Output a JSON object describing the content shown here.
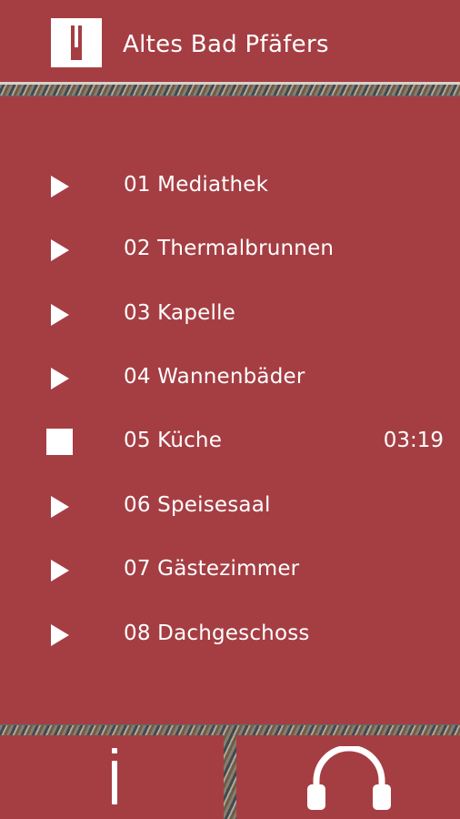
{
  "header": {
    "app_title": "Altes Bad Pfäfers",
    "logo_icon": "logo-icon"
  },
  "tracks": [
    {
      "label": "01 Mediathek",
      "state": "play",
      "icon": "play-icon"
    },
    {
      "label": "02 Thermalbrunnen",
      "state": "play",
      "icon": "play-icon"
    },
    {
      "label": "03 Kapelle",
      "state": "play",
      "icon": "play-icon"
    },
    {
      "label": "04 Wannenbäder",
      "state": "play",
      "icon": "play-icon"
    },
    {
      "label": "05 Küche",
      "state": "stop",
      "icon": "stop-icon",
      "time": "03:19"
    },
    {
      "label": "06 Speisesaal",
      "state": "play",
      "icon": "play-icon"
    },
    {
      "label": "07 Gästezimmer",
      "state": "play",
      "icon": "play-icon"
    },
    {
      "label": "08 Dachgeschoss",
      "state": "play",
      "icon": "play-icon"
    }
  ],
  "footer": {
    "left_icon": "info-icon",
    "right_icon": "headphones-icon"
  },
  "colors": {
    "accent": "#a53e43",
    "text": "#ffffff",
    "divider": "#d8d2cc"
  }
}
